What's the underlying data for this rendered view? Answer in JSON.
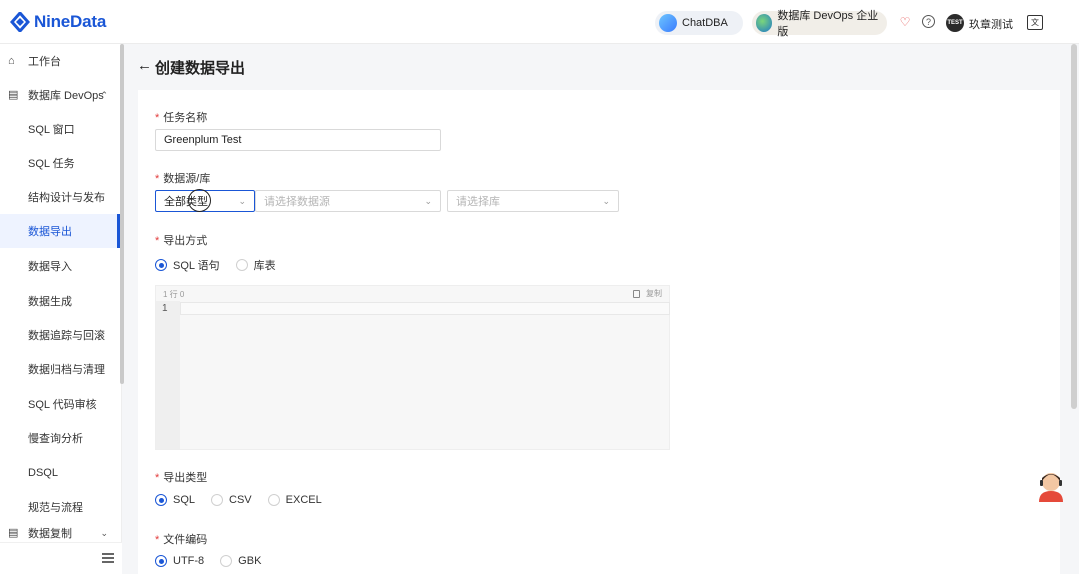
{
  "app": {
    "brand": "NineData"
  },
  "topbar": {
    "chatdba_label": "ChatDBA",
    "devops_label": "数据库 DevOps 企业版",
    "avatar_text": "TEST",
    "username": "玖章测试"
  },
  "sidebar": {
    "items": [
      {
        "label": "工作台",
        "icon": "home-icon",
        "level": "top"
      },
      {
        "label": "数据库 DevOps",
        "icon": "database-icon",
        "level": "top",
        "expanded": true
      },
      {
        "label": "SQL 窗口",
        "level": "sub"
      },
      {
        "label": "SQL 任务",
        "level": "sub"
      },
      {
        "label": "结构设计与发布",
        "level": "sub"
      },
      {
        "label": "数据导出",
        "level": "sub",
        "active": true
      },
      {
        "label": "数据导入",
        "level": "sub"
      },
      {
        "label": "数据生成",
        "level": "sub"
      },
      {
        "label": "数据追踪与回滚",
        "level": "sub"
      },
      {
        "label": "数据归档与清理",
        "level": "sub"
      },
      {
        "label": "SQL 代码审核",
        "level": "sub"
      },
      {
        "label": "慢查询分析",
        "level": "sub"
      },
      {
        "label": "DSQL",
        "level": "sub"
      },
      {
        "label": "规范与流程",
        "level": "sub"
      },
      {
        "label": "数据复制",
        "icon": "replication-icon",
        "level": "top"
      }
    ]
  },
  "page": {
    "title": "创建数据导出"
  },
  "form": {
    "task_name": {
      "label": "任务名称",
      "value": "Greenplum Test"
    },
    "datasource": {
      "label": "数据源/库",
      "type_select": "全部类型",
      "source_placeholder": "请选择数据源",
      "db_placeholder": "请选择库"
    },
    "export_method": {
      "label": "导出方式",
      "options": [
        "SQL 语句",
        "库表"
      ],
      "selected": "SQL 语句"
    },
    "editor": {
      "position": "1 行  0",
      "copy_label": "复制",
      "line_numbers": [
        "1"
      ]
    },
    "export_type": {
      "label": "导出类型",
      "options": [
        "SQL",
        "CSV",
        "EXCEL"
      ],
      "selected": "SQL"
    },
    "file_encoding": {
      "label": "文件编码",
      "options": [
        "UTF-8",
        "GBK"
      ],
      "selected": "UTF-8"
    }
  },
  "colors": {
    "accent": "#1a56d6",
    "required": "#e23b3b"
  }
}
